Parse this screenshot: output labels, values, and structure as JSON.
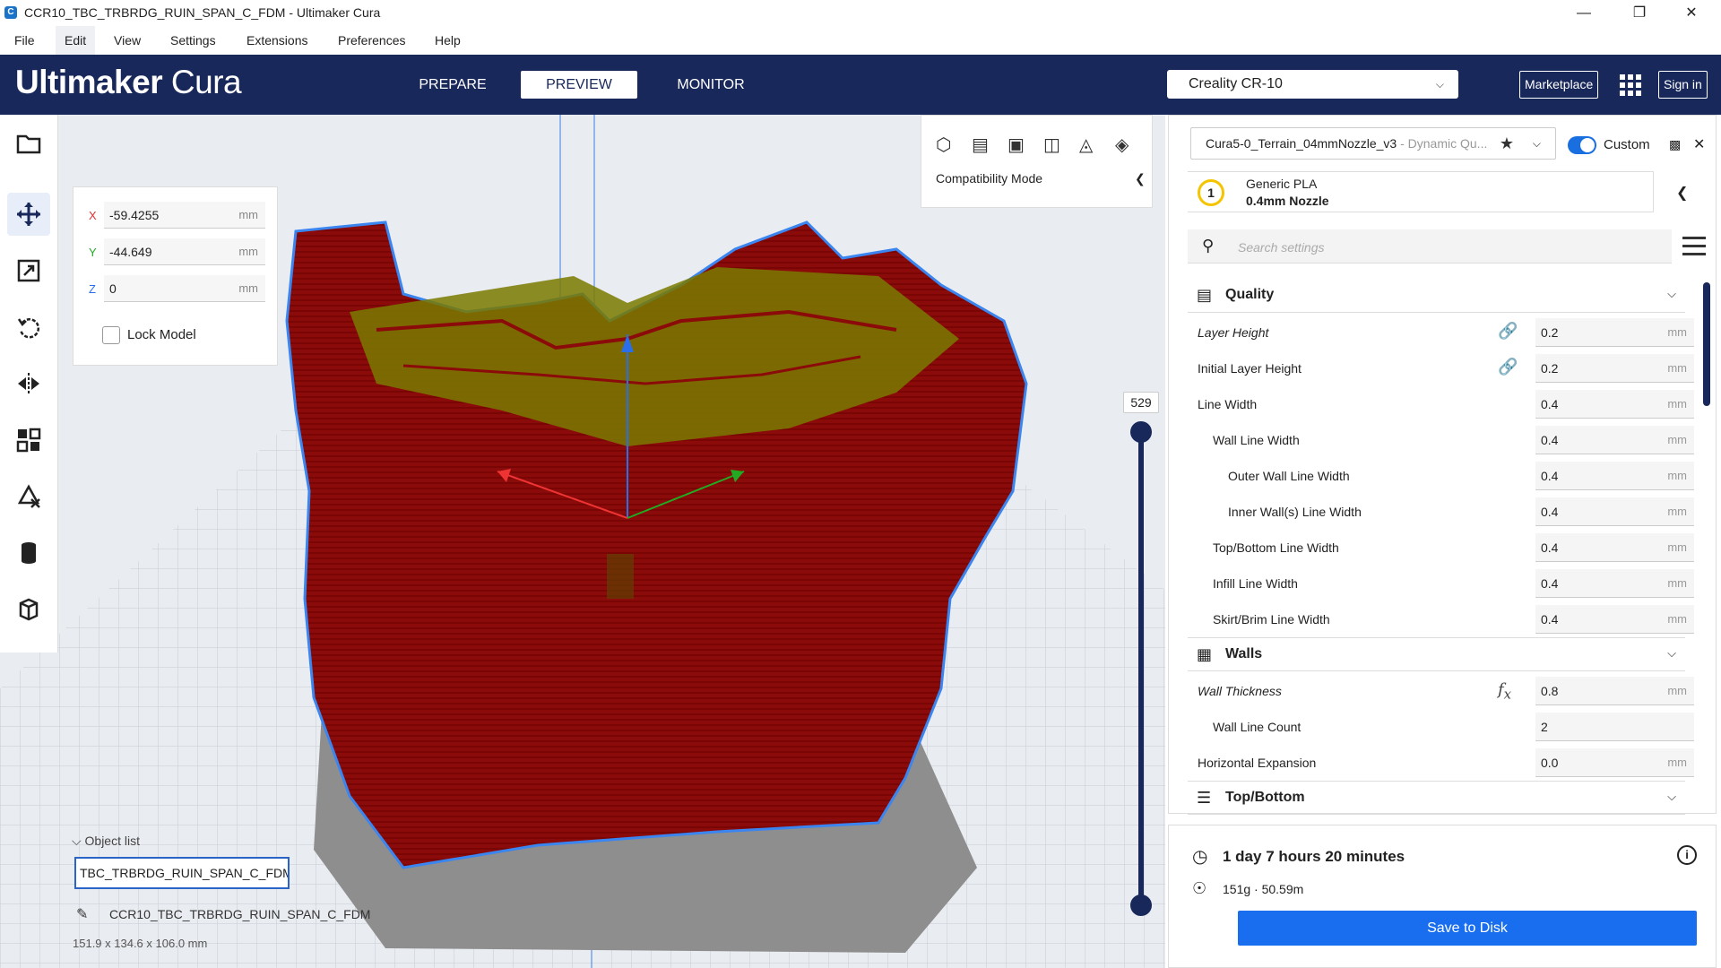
{
  "window": {
    "title": "CCR10_TBC_TRBRDG_RUIN_SPAN_C_FDM - Ultimaker Cura",
    "minimize": "—",
    "maximize": "❐",
    "close": "✕"
  },
  "menu": [
    "File",
    "Edit",
    "View",
    "Settings",
    "Extensions",
    "Preferences",
    "Help"
  ],
  "header": {
    "logo_bold": "Ultimaker",
    "logo_light": " Cura",
    "stages": [
      "PREPARE",
      "PREVIEW",
      "MONITOR"
    ],
    "active_stage": "PREVIEW",
    "printer": "Creality CR-10",
    "marketplace": "Marketplace",
    "signin": "Sign in"
  },
  "move_panel": {
    "x_label": "X",
    "x_value": "-59.4255",
    "y_label": "Y",
    "y_value": "-44.649",
    "z_label": "Z",
    "z_value": "0",
    "unit": "mm",
    "lock_label": "Lock Model"
  },
  "view_panel": {
    "compat_label": "Compatibility Mode"
  },
  "layer_slider": {
    "value": "529"
  },
  "object_list": {
    "header": "Object list",
    "file": "TBC_TRBRDG_RUIN_SPAN_C_FDM.stl",
    "job_name": "CCR10_TBC_TRBRDG_RUIN_SPAN_C_FDM",
    "dimensions": "151.9 x 134.6 x 106.0 mm"
  },
  "settings": {
    "profile_name": "Cura5-0_Terrain_04mmNozzle_v3",
    "profile_suffix": " - Dynamic Qu...",
    "custom_label": "Custom",
    "material": "Generic PLA",
    "nozzle": "0.4mm Nozzle",
    "extruder": "1",
    "search_placeholder": "Search settings",
    "categories": {
      "quality": "Quality",
      "walls": "Walls",
      "topbottom": "Top/Bottom"
    },
    "quality_rows": [
      {
        "label": "Layer Height",
        "value": "0.2",
        "unit": "mm"
      },
      {
        "label": "Initial Layer Height",
        "value": "0.2",
        "unit": "mm"
      },
      {
        "label": "Line Width",
        "value": "0.4",
        "unit": "mm"
      },
      {
        "label": "Wall Line Width",
        "value": "0.4",
        "unit": "mm"
      },
      {
        "label": "Outer Wall Line Width",
        "value": "0.4",
        "unit": "mm"
      },
      {
        "label": "Inner Wall(s) Line Width",
        "value": "0.4",
        "unit": "mm"
      },
      {
        "label": "Top/Bottom Line Width",
        "value": "0.4",
        "unit": "mm"
      },
      {
        "label": "Infill Line Width",
        "value": "0.4",
        "unit": "mm"
      },
      {
        "label": "Skirt/Brim Line Width",
        "value": "0.4",
        "unit": "mm"
      }
    ],
    "walls_rows": [
      {
        "label": "Wall Thickness",
        "value": "0.8",
        "unit": "mm"
      },
      {
        "label": "Wall Line Count",
        "value": "2",
        "unit": ""
      },
      {
        "label": "Horizontal Expansion",
        "value": "0.0",
        "unit": "mm"
      }
    ]
  },
  "print_info": {
    "time": "1 day 7 hours 20 minutes",
    "material": "151g · 50.59m",
    "save_button": "Save to Disk"
  },
  "colors": {
    "header": "#19285a",
    "accent": "#196ef0",
    "model": "#8b0a0a",
    "model_top": "#7a7a00",
    "outline": "#2a7cf0"
  }
}
